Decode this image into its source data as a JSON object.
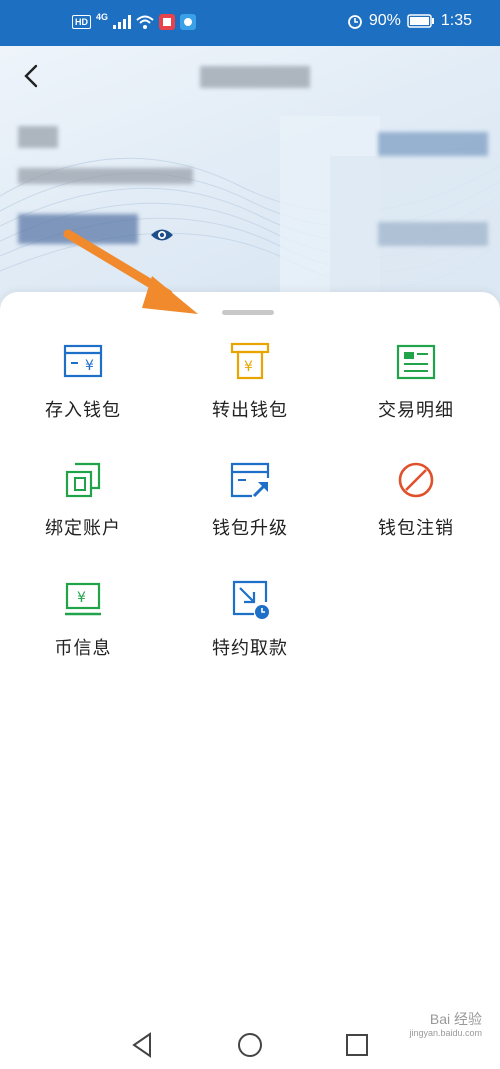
{
  "status_bar": {
    "network": "4G",
    "hd_badge": "HD",
    "battery_percent": "90%",
    "time": "1:35"
  },
  "menu": {
    "items": [
      {
        "label": "存入钱包",
        "icon": "deposit-wallet-icon",
        "color": "#1e6fc8"
      },
      {
        "label": "转出钱包",
        "icon": "withdraw-wallet-icon",
        "color": "#e8a400"
      },
      {
        "label": "交易明细",
        "icon": "transaction-detail-icon",
        "color": "#21a34a"
      },
      {
        "label": "绑定账户",
        "icon": "bind-account-icon",
        "color": "#21a34a"
      },
      {
        "label": "钱包升级",
        "icon": "wallet-upgrade-icon",
        "color": "#1e6fc8"
      },
      {
        "label": "钱包注销",
        "icon": "wallet-cancel-icon",
        "color": "#e0502a"
      },
      {
        "label": "币信息",
        "icon": "coin-info-icon",
        "color": "#21a34a"
      },
      {
        "label": "特约取款",
        "icon": "scheduled-withdraw-icon",
        "color": "#1e6fc8"
      }
    ]
  },
  "watermark": {
    "text": "Bai 经验",
    "sub": "jingyan.baidu.com"
  },
  "colors": {
    "status_bar": "#1d6fc2",
    "annotation_arrow": "#f08a2c"
  }
}
